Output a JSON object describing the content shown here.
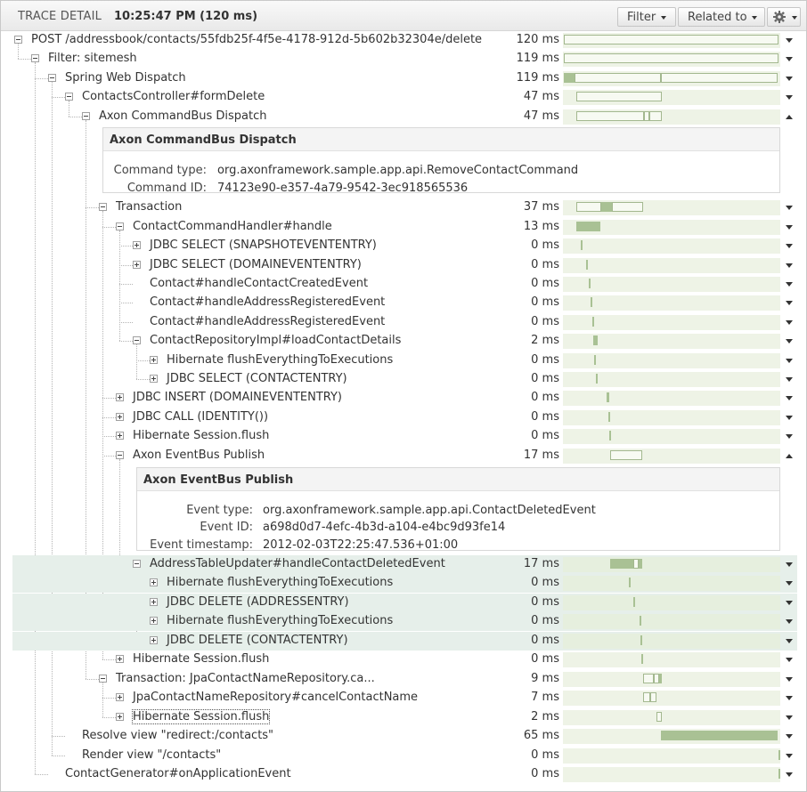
{
  "header": {
    "label": "TRACE DETAIL",
    "time": "10:25:47 PM (120 ms)",
    "filter_label": "Filter",
    "related_label": "Related to"
  },
  "colors": {
    "bar_fill": "#a9c194",
    "bar_track": "#eef3e6",
    "highlight_row": "#e6efea"
  },
  "rows": [
    {
      "label": "POST /addressbook/contacts/55fdb25f-4f5e-4178-912d-5b602b32304e/delete",
      "time": "120 ms",
      "toggle": "minus",
      "expanded": false
    },
    {
      "label": "Filter: sitemesh",
      "time": "119 ms",
      "toggle": "minus",
      "expanded": false
    },
    {
      "label": "Spring Web Dispatch",
      "time": "119 ms",
      "toggle": "minus",
      "expanded": false
    },
    {
      "label": "ContactsController#formDelete",
      "time": "47 ms",
      "toggle": "minus",
      "expanded": false
    },
    {
      "label": "Axon CommandBus Dispatch",
      "time": "47 ms",
      "toggle": "minus",
      "expanded": true
    },
    {
      "label": "Transaction",
      "time": "37 ms",
      "toggle": "minus",
      "expanded": false
    },
    {
      "label": "ContactCommandHandler#handle",
      "time": "13 ms",
      "toggle": "minus",
      "expanded": false
    },
    {
      "label": "JDBC SELECT (SNAPSHOTEVENTENTRY)",
      "time": "0 ms",
      "toggle": "plus",
      "expanded": false
    },
    {
      "label": "JDBC SELECT (DOMAINEVENTENTRY)",
      "time": "0 ms",
      "toggle": "plus",
      "expanded": false
    },
    {
      "label": "Contact#handleContactCreatedEvent",
      "time": "0 ms",
      "toggle": "none",
      "expanded": false
    },
    {
      "label": "Contact#handleAddressRegisteredEvent",
      "time": "0 ms",
      "toggle": "none",
      "expanded": false
    },
    {
      "label": "Contact#handleAddressRegisteredEvent",
      "time": "0 ms",
      "toggle": "none",
      "expanded": false
    },
    {
      "label": "ContactRepositoryImpl#loadContactDetails",
      "time": "2 ms",
      "toggle": "minus",
      "expanded": false
    },
    {
      "label": "Hibernate flushEverythingToExecutions",
      "time": "0 ms",
      "toggle": "plus",
      "expanded": false
    },
    {
      "label": "JDBC SELECT (CONTACTENTRY)",
      "time": "0 ms",
      "toggle": "plus",
      "expanded": false
    },
    {
      "label": "JDBC INSERT (DOMAINEVENTENTRY)",
      "time": "0 ms",
      "toggle": "plus",
      "expanded": false
    },
    {
      "label": "JDBC CALL (IDENTITY())",
      "time": "0 ms",
      "toggle": "plus",
      "expanded": false
    },
    {
      "label": "Hibernate Session.flush",
      "time": "0 ms",
      "toggle": "plus",
      "expanded": false
    },
    {
      "label": "Axon EventBus Publish",
      "time": "17 ms",
      "toggle": "minus",
      "expanded": true
    },
    {
      "label": "AddressTableUpdater#handleContactDeletedEvent",
      "time": "17 ms",
      "toggle": "minus",
      "expanded": false
    },
    {
      "label": "Hibernate flushEverythingToExecutions",
      "time": "0 ms",
      "toggle": "plus",
      "expanded": false
    },
    {
      "label": "JDBC DELETE (ADDRESSENTRY)",
      "time": "0 ms",
      "toggle": "plus",
      "expanded": false
    },
    {
      "label": "Hibernate flushEverythingToExecutions",
      "time": "0 ms",
      "toggle": "plus",
      "expanded": false
    },
    {
      "label": "JDBC DELETE (CONTACTENTRY)",
      "time": "0 ms",
      "toggle": "plus",
      "expanded": false
    },
    {
      "label": "Hibernate Session.flush",
      "time": "0 ms",
      "toggle": "plus",
      "expanded": false
    },
    {
      "label": "Transaction: JpaContactNameRepository.ca...",
      "time": "9 ms",
      "toggle": "minus",
      "expanded": false
    },
    {
      "label": "JpaContactNameRepository#cancelContactName",
      "time": "7 ms",
      "toggle": "plus",
      "expanded": false
    },
    {
      "label": "Hibernate Session.flush",
      "time": "2 ms",
      "toggle": "plus",
      "expanded": false
    },
    {
      "label": "Resolve view \"redirect:/contacts\"",
      "time": "65 ms",
      "toggle": "none",
      "expanded": false
    },
    {
      "label": "Render view \"/contacts\"",
      "time": "0 ms",
      "toggle": "none",
      "expanded": false
    },
    {
      "label": "ContactGenerator#onApplicationEvent",
      "time": "0 ms",
      "toggle": "none",
      "expanded": false
    }
  ],
  "details": [
    {
      "title": "Axon CommandBus Dispatch",
      "fields": [
        {
          "label": "Command type:",
          "value": "org.axonframework.sample.app.api.RemoveContactCommand"
        },
        {
          "label": "Command ID:",
          "value": "74123e90-e357-4a79-9542-3ec918565536"
        }
      ]
    },
    {
      "title": "Axon EventBus Publish",
      "fields": [
        {
          "label": "Event type:",
          "value": "org.axonframework.sample.app.api.ContactDeletedEvent"
        },
        {
          "label": "Event ID:",
          "value": "a698d0d7-4efc-4b3d-a104-e4bc9d93fe14"
        },
        {
          "label": "Event timestamp:",
          "value": "2012-02-03T22:25:47.536+01:00"
        }
      ]
    }
  ]
}
